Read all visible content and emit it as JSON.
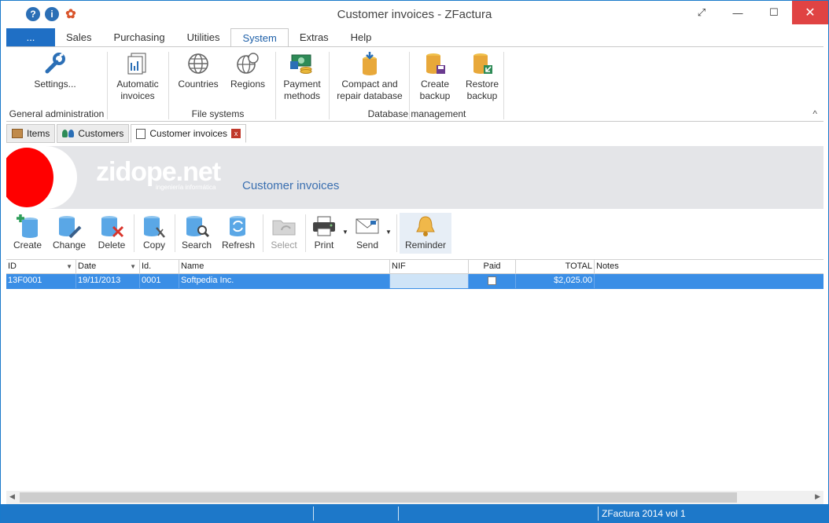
{
  "title": "Customer invoices - ZFactura",
  "window_controls": {
    "restore": "⤢",
    "minimize": "—",
    "maximize": "☐",
    "close": "✕"
  },
  "tabs": [
    {
      "label": "...",
      "kind": "file"
    },
    {
      "label": "Sales"
    },
    {
      "label": "Purchasing"
    },
    {
      "label": "Utilities"
    },
    {
      "label": "System",
      "active": true
    },
    {
      "label": "Extras"
    },
    {
      "label": "Help"
    }
  ],
  "ribbon": {
    "settings": "Settings...",
    "automatic_l1": "Automatic",
    "automatic_l2": "invoices",
    "countries": "Countries",
    "regions": "Regions",
    "payment_l1": "Payment",
    "payment_l2": "methods",
    "compact_l1": "Compact and",
    "compact_l2": "repair database",
    "create_backup_l1": "Create",
    "create_backup_l2": "backup",
    "restore_l1": "Restore",
    "restore_l2": "backup",
    "groups": {
      "general": "General administration",
      "file_systems": "File systems",
      "database": "Database management"
    },
    "collapse": "^"
  },
  "doc_tabs": {
    "items": "Items",
    "customers": "Customers",
    "invoices": "Customer invoices",
    "close": "x"
  },
  "banner": {
    "brand": "zidope.net",
    "brand_sub": "ingeniería informática",
    "title": "Customer invoices"
  },
  "toolbar": {
    "create": "Create",
    "change": "Change",
    "delete": "Delete",
    "copy": "Copy",
    "search": "Search",
    "refresh": "Refresh",
    "select": "Select",
    "print": "Print",
    "send": "Send",
    "reminder": "Reminder"
  },
  "grid": {
    "columns": [
      "ID",
      "Date",
      "Id.",
      "Name",
      "NIF",
      "Paid",
      "TOTAL",
      "Notes"
    ],
    "rows": [
      {
        "id": "13F0001",
        "date": "19/11/2013",
        "idn": "0001",
        "name": "Softpedia Inc.",
        "nif": "",
        "paid": false,
        "total": "$2,025.00",
        "notes": ""
      }
    ]
  },
  "status": {
    "version": "ZFactura 2014 vol 1"
  },
  "colors": {
    "accent": "#1d78c9",
    "selection": "#3a8ee6",
    "brand_red": "#ff0000"
  }
}
